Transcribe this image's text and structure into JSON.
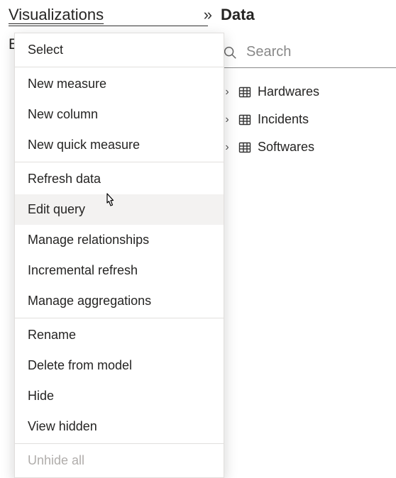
{
  "viz": {
    "title": "Visualizations",
    "partial": "E"
  },
  "data": {
    "title": "Data",
    "search_placeholder": "Search",
    "tables": [
      {
        "label": "Hardwares"
      },
      {
        "label": "Incidents"
      },
      {
        "label": "Softwares"
      }
    ]
  },
  "menu": {
    "items": [
      {
        "label": "Select",
        "sep_after": true
      },
      {
        "label": "New measure"
      },
      {
        "label": "New column"
      },
      {
        "label": "New quick measure",
        "sep_after": true
      },
      {
        "label": "Refresh data"
      },
      {
        "label": "Edit query",
        "hovered": true
      },
      {
        "label": "Manage relationships"
      },
      {
        "label": "Incremental refresh"
      },
      {
        "label": "Manage aggregations",
        "sep_after": true
      },
      {
        "label": "Rename"
      },
      {
        "label": "Delete from model"
      },
      {
        "label": "Hide"
      },
      {
        "label": "View hidden",
        "sep_after": true
      },
      {
        "label": "Unhide all",
        "disabled": true
      }
    ]
  }
}
